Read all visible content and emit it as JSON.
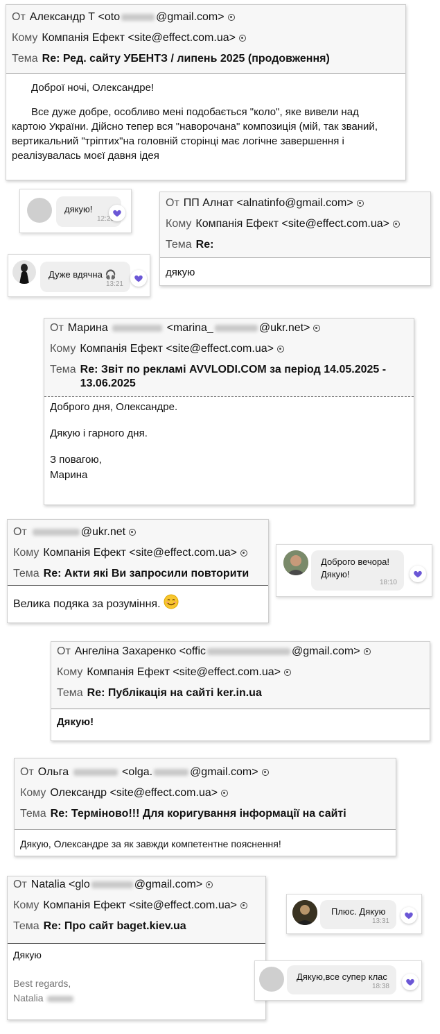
{
  "labels": {
    "from": "От",
    "to": "Кому",
    "subject": "Тема"
  },
  "colors": {
    "heart": "#6b57d6",
    "header_bg": "#f7f7f7",
    "bubble_bg": "#efefef"
  },
  "email1": {
    "from_a": "Александр Т <oto",
    "from_b": "@gmail.com>",
    "to": "Компанія Ефект <site@effect.com.ua>",
    "subject": "Re: Ред. сайту УБЕНТЗ / липень 2025 (продовження)",
    "body": [
      "Доброї ночі, Олександре!",
      "Все дуже добре, особливо мені подобається \"коло\", яке вивели над картою України. Дійсно тепер вся \"наворочана\" композиція (мій, так званий, вертикальний \"тріптих\"на головній сторінці має логічне завершення і реалізувалась моєї давня ідея"
    ]
  },
  "chat1": {
    "text": "дякую!",
    "time": "12:25"
  },
  "email2": {
    "from": "ПП Алнат <alnatinfo@gmail.com>",
    "to": "Компанія Ефект <site@effect.com.ua>",
    "subject": "Re:",
    "body": "дякую"
  },
  "chat2": {
    "text": "Дуже вдячна 🎧",
    "time": "13:21"
  },
  "email3": {
    "from_a": "Марина",
    "from_b": "<marina_",
    "from_c": "@ukr.net>",
    "to": "Компанія Ефект <site@effect.com.ua>",
    "subject": "Re: Звіт по рекламі AVVLODI.COM за період 14.05.2025 - 13.06.2025",
    "body": [
      "Доброго дня, Олександре.",
      "Дякую і гарного дня.",
      "З повагою,",
      "Марина"
    ]
  },
  "email4": {
    "from_b": "@ukr.net",
    "to": "Компанія Ефект <site@effect.com.ua>",
    "subject": "Re: Акти які Ви запросили повторити",
    "body": "Велика подяка за розуміння."
  },
  "chat3": {
    "line1": "Доброго вечора!",
    "line2": "Дякую!",
    "time": "18:10"
  },
  "email5": {
    "from_a": "Ангеліна Захаренко <offic",
    "from_b": "@gmail.com>",
    "to": "Компанія Ефект <site@effect.com.ua>",
    "subject": "Re: Публікація на сайті ker.in.ua",
    "body": "Дякую!"
  },
  "email6": {
    "from_a": "Ольга",
    "from_b": "<olga.",
    "from_c": "@gmail.com>",
    "to": "Олександр <site@effect.com.ua>",
    "subject": "Re: Терміново!!! Для коригування інформації на сайті",
    "body": "Дякую, Олександре за як завжди компетентне пояснення!"
  },
  "email7": {
    "from_a": "Natalia <glo",
    "from_b": "@gmail.com>",
    "to": "Компанія Ефект <site@effect.com.ua>",
    "subject": "Re: Про сайт baget.kiev.ua",
    "body": "Дякую",
    "sig1": "Best regards,",
    "sig2": "Natalia"
  },
  "chat4": {
    "text": "Плюс. Дякую",
    "time": "13:31"
  },
  "chat5": {
    "text": "Дякую,все супер клас",
    "time": "18:38"
  }
}
